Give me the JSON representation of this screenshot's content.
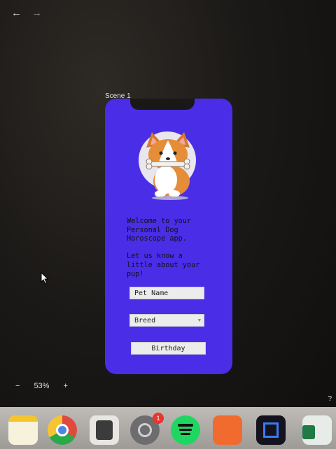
{
  "nav": {
    "back_icon": "arrow-left-icon",
    "forward_icon": "arrow-right-icon",
    "back": "←",
    "forward": "→"
  },
  "scene": {
    "label": "Scene 1"
  },
  "screen": {
    "background": "#4a2de6",
    "welcome_text": "Welcome to your\nPersonal Dog\nHoroscope app.\n\nLet us know a\nlittle about your\npup!",
    "fields": {
      "pet_name": "Pet Name",
      "breed": "Breed",
      "birthday": "Birthday"
    }
  },
  "zoom": {
    "minus": "−",
    "level": "53%",
    "plus": "+"
  },
  "help": {
    "label": "?"
  },
  "dock": {
    "settings_badge": "1",
    "apps": [
      "notes-icon",
      "chrome-icon",
      "calculator-icon",
      "system-settings-icon",
      "spotify-icon",
      "pages-icon",
      "app-icon",
      "excel-icon"
    ]
  }
}
